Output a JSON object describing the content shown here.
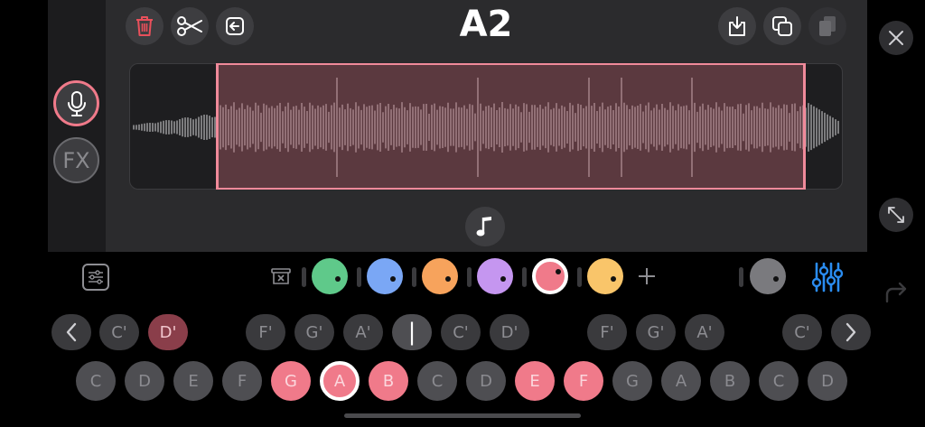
{
  "header": {
    "title": "A2"
  },
  "side": {
    "fx_label": "FX"
  },
  "chords": {
    "row": [
      {
        "label": "C'",
        "active": false
      },
      {
        "label": "D'",
        "active": true
      },
      {
        "label": "F'",
        "active": false
      },
      {
        "label": "G'",
        "active": false
      },
      {
        "label": "A'",
        "active": false
      },
      {
        "label": "|",
        "active": false
      },
      {
        "label": "C'",
        "active": false
      },
      {
        "label": "D'",
        "active": false
      },
      {
        "label": "F'",
        "active": false
      },
      {
        "label": "G'",
        "active": false
      },
      {
        "label": "A'",
        "active": false
      },
      {
        "label": "C'",
        "active": false
      }
    ]
  },
  "keys": [
    {
      "label": "C",
      "state": "off"
    },
    {
      "label": "D",
      "state": "off"
    },
    {
      "label": "E",
      "state": "off"
    },
    {
      "label": "F",
      "state": "off"
    },
    {
      "label": "G",
      "state": "on"
    },
    {
      "label": "A",
      "state": "selected"
    },
    {
      "label": "B",
      "state": "on"
    },
    {
      "label": "C",
      "state": "off"
    },
    {
      "label": "D",
      "state": "off"
    },
    {
      "label": "E",
      "state": "on"
    },
    {
      "label": "F",
      "state": "on"
    },
    {
      "label": "G",
      "state": "off"
    },
    {
      "label": "A",
      "state": "off"
    },
    {
      "label": "B",
      "state": "off"
    },
    {
      "label": "C",
      "state": "off"
    },
    {
      "label": "D",
      "state": "off"
    }
  ],
  "colors": {
    "accent_pink": "#f07a8a",
    "delete_red": "#e8505b",
    "mixer_blue": "#2a8cf0",
    "knobs": [
      "#5fc98a",
      "#7aa7f5",
      "#f7a35c",
      "#c596f0",
      "#f07a8a",
      "#f9c56a",
      "#7a7a7e"
    ]
  },
  "icons": [
    "trash-icon",
    "scissors-icon",
    "back-arrow-icon",
    "download-icon",
    "copy-icon",
    "paste-icon",
    "close-icon",
    "microphone-icon",
    "fx-icon",
    "music-note-icon",
    "expand-icon",
    "settings-sliders-icon",
    "clear-icon",
    "plus-icon",
    "mixer-icon",
    "redo-icon",
    "chevron-left-icon",
    "chevron-right-icon"
  ]
}
